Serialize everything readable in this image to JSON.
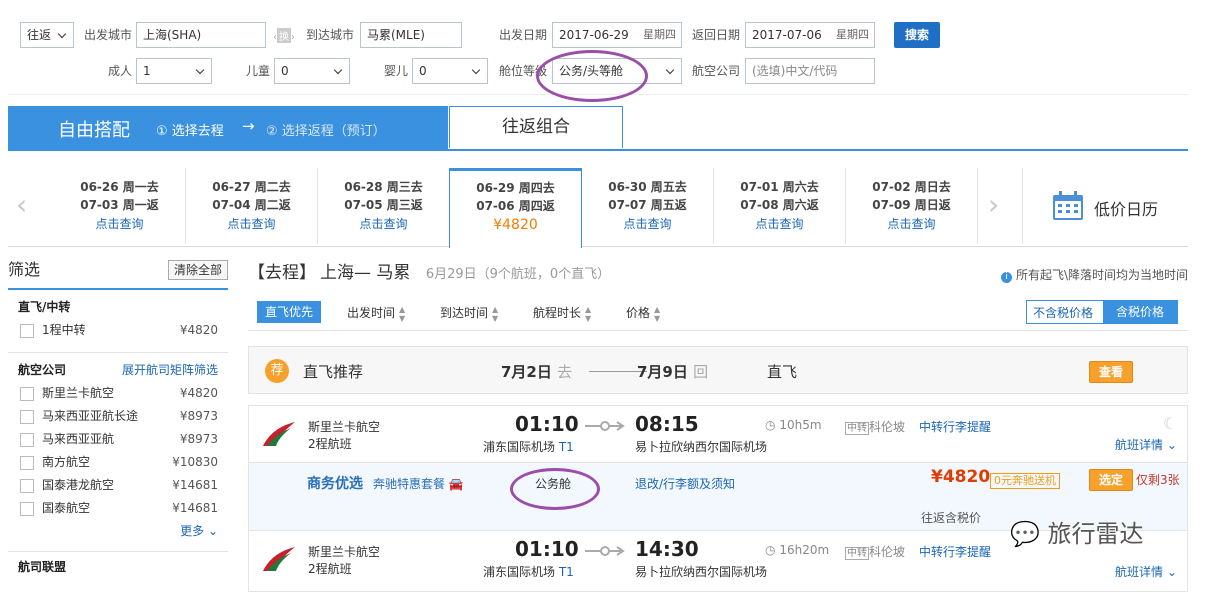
{
  "search": {
    "trip_type": "往返",
    "from_label": "出发城市",
    "from_value": "上海(SHA)",
    "swap_label": "换",
    "to_label": "到达城市",
    "to_value": "马累(MLE)",
    "depart_label": "出发日期",
    "depart_date": "2017-06-29",
    "depart_weekday": "星期四",
    "return_label": "返回日期",
    "return_date": "2017-07-06",
    "return_weekday": "星期四",
    "search_button": "搜索",
    "adult_label": "成人",
    "adult_value": "1",
    "child_label": "儿童",
    "child_value": "0",
    "infant_label": "婴儿",
    "infant_value": "0",
    "cabin_label": "舱位等级",
    "cabin_value": "公务/头等舱",
    "airline_label": "航空公司",
    "airline_placeholder": "(选填)中文/代码"
  },
  "tabs": {
    "free_combo": "自由搭配",
    "step1": "① 选择去程",
    "arrow": "→",
    "step2": "② 选择返程（预订）",
    "round_trip": "往返组合"
  },
  "dates": [
    {
      "l1": "06-26 周一去",
      "l2": "07-03 周一返",
      "link": "点击查询",
      "price": ""
    },
    {
      "l1": "06-27 周二去",
      "l2": "07-04 周二返",
      "link": "点击查询",
      "price": ""
    },
    {
      "l1": "06-28 周三去",
      "l2": "07-05 周三返",
      "link": "点击查询",
      "price": ""
    },
    {
      "l1": "06-29 周四去",
      "l2": "07-06 周四返",
      "link": "",
      "price": "¥4820"
    },
    {
      "l1": "06-30 周五去",
      "l2": "07-07 周五返",
      "link": "点击查询",
      "price": ""
    },
    {
      "l1": "07-01 周六去",
      "l2": "07-08 周六返",
      "link": "点击查询",
      "price": ""
    },
    {
      "l1": "07-02 周日去",
      "l2": "07-09 周日返",
      "link": "点击查询",
      "price": ""
    }
  ],
  "calendar_label": "低价日历",
  "sidebar": {
    "title": "筛选",
    "clear_all": "清除全部",
    "direct_title": "直飞/中转",
    "direct_items": [
      {
        "label": "1程中转",
        "price": "¥4820"
      }
    ],
    "airline_title": "航空公司",
    "airline_matrix": "展开航司矩阵筛选",
    "airlines": [
      {
        "label": "斯里兰卡航空",
        "price": "¥4820"
      },
      {
        "label": "马来西亚亚航长途",
        "price": "¥8973"
      },
      {
        "label": "马来西亚亚航",
        "price": "¥8973"
      },
      {
        "label": "南方航空",
        "price": "¥10830"
      },
      {
        "label": "国泰港龙航空",
        "price": "¥14681"
      },
      {
        "label": "国泰航空",
        "price": "¥14681"
      }
    ],
    "more": "更多",
    "alliance_title": "航司联盟"
  },
  "main": {
    "heading_tag": "【去程】",
    "heading_route": "上海— 马累",
    "heading_sub": "6月29日（9个航班，0个直飞）",
    "notice": "所有起飞\\降落时间均为当地时间",
    "sort": [
      "直飞优先",
      "出发时间",
      "到达时间",
      "航程时长",
      "价格"
    ],
    "price_toggle": [
      "不含税价格",
      "含税价格"
    ],
    "recommend": {
      "badge": "荐",
      "title": "直飞推荐",
      "go_date": "7月2日",
      "go_tag": "去",
      "back_date": "7月9日",
      "back_tag": "回",
      "type": "直飞",
      "button": "查看"
    },
    "flights": [
      {
        "airline": "斯里兰卡航空",
        "legs": "2程航班",
        "dep_time": "01:10",
        "dep_airport": "浦东国际机场",
        "dep_terminal": "T1",
        "arr_time": "08:15",
        "arr_airport": "易卜拉欣纳西尔国际机场",
        "duration": "10h5m",
        "stop_tag": "中转",
        "stop_city": "科伦坡",
        "luggage": "中转行李提醒",
        "details": "航班详情"
      },
      {
        "airline": "斯里兰卡航空",
        "legs": "2程航班",
        "dep_time": "01:10",
        "dep_airport": "浦东国际机场",
        "dep_terminal": "T1",
        "arr_time": "14:30",
        "arr_airport": "易卜拉欣纳西尔国际机场",
        "duration": "16h20m",
        "stop_tag": "中转",
        "stop_city": "科伦坡",
        "luggage": "中转行李提醒",
        "details": "航班详情"
      }
    ],
    "offer": {
      "brand": "商务优选",
      "benz": "奔驰特惠套餐",
      "cabin": "公务舱",
      "refund": "退改/行李额及须知",
      "price": "¥4820",
      "transfer": "0元奔驰送机",
      "select": "选定",
      "remaining": "仅剩3张",
      "tax_note": "往返含税价"
    },
    "watermark": "旅行雷达"
  }
}
